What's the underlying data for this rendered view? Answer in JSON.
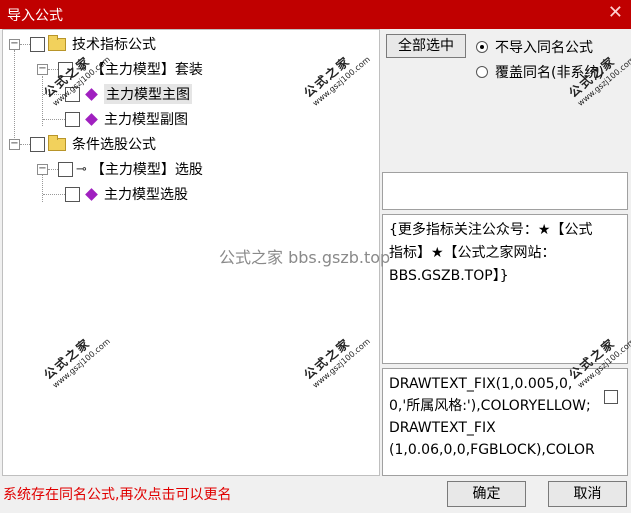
{
  "window": {
    "title": "导入公式",
    "close_glyph": "✕"
  },
  "tree": {
    "groups": [
      {
        "label": "技术指标公式",
        "children": [
          {
            "label": "【主力模型】套装",
            "children": [
              {
                "label": "主力模型主图"
              },
              {
                "label": "主力模型副图"
              }
            ]
          }
        ]
      },
      {
        "label": "条件选股公式",
        "children": [
          {
            "label": "【主力模型】选股",
            "children": [
              {
                "label": "主力模型选股"
              }
            ]
          }
        ]
      }
    ],
    "expander_glyph": "−",
    "key_glyph": "⊸"
  },
  "controls": {
    "select_all": "全部选中",
    "radio_no_import": "不导入同名公式",
    "radio_overwrite": "覆盖同名(非系统)",
    "ok": "确定",
    "cancel": "取消"
  },
  "description": "{更多指标关注公众号：★【公式指标】★【公式之家网站：BBS.GSZB.TOP】}",
  "formula": "DRAWTEXT_FIX(1,0.005,0,0,'所属风格:'),COLORYELLOW;\nDRAWTEXT_FIX\n(1,0.06,0,0,FGBLOCK),COLOR",
  "status": "系统存在同名公式,再次点击可以更名",
  "watermarks": {
    "center": "公式之家 bbs.gszb.top",
    "stamp_big": "公式之家",
    "stamp_small": "www.gszj100.com"
  },
  "colors": {
    "titlebar": "#c00000",
    "status_text": "#e00000",
    "diamond_icon": "#a020c0",
    "folder_icon": "#f2d15c"
  }
}
